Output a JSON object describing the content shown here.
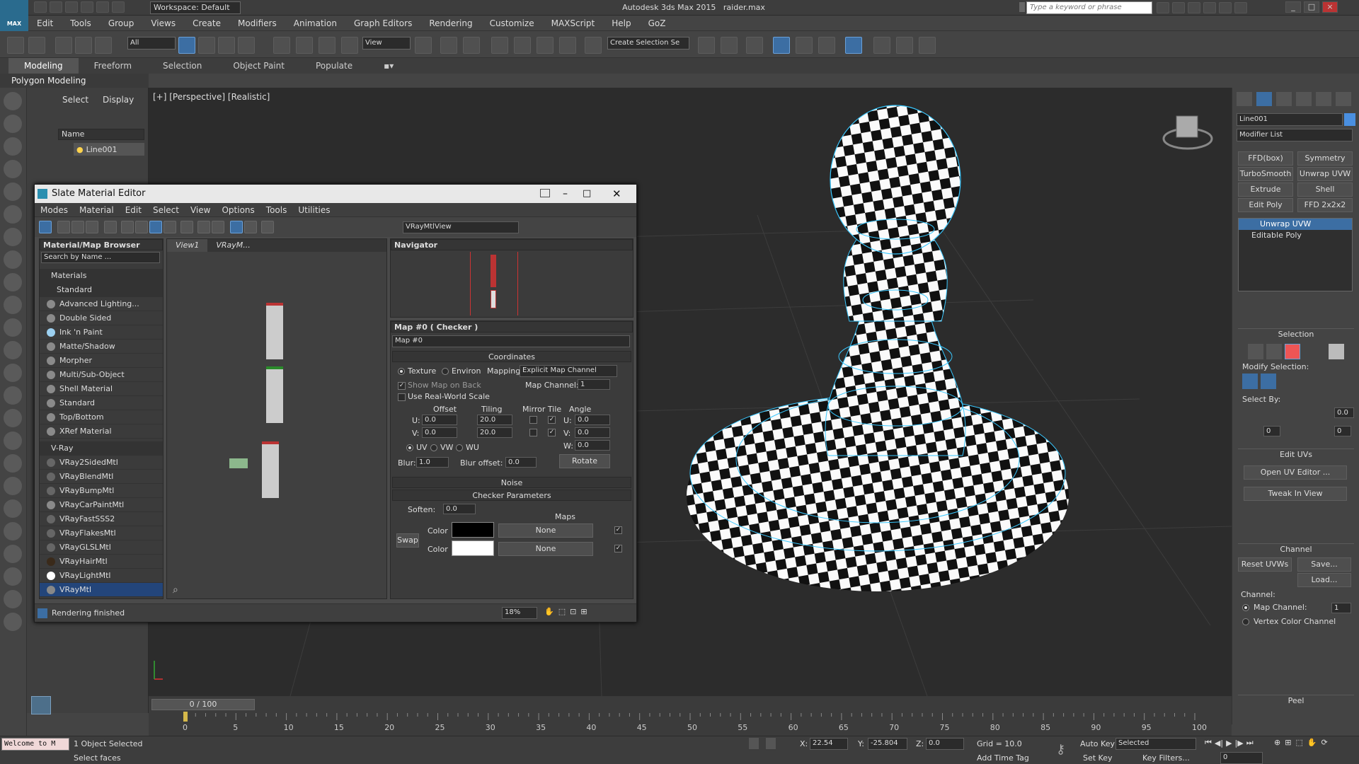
{
  "app": {
    "title": "Autodesk 3ds Max 2015",
    "file": "raider.max",
    "workspace": "Workspace: Default",
    "search_placeholder": "Type a keyword or phrase",
    "logo": "MAX"
  },
  "menu": [
    "Edit",
    "Tools",
    "Group",
    "Views",
    "Create",
    "Modifiers",
    "Animation",
    "Graph Editors",
    "Rendering",
    "Customize",
    "MAXScript",
    "Help",
    "GoZ"
  ],
  "toolbar": {
    "selection_filter": "All",
    "ref_coord": "View",
    "named_selection": "Create Selection Se"
  },
  "ribbon": {
    "tabs": [
      "Modeling",
      "Freeform",
      "Selection",
      "Object Paint",
      "Populate"
    ],
    "active": "Modeling",
    "sub": "Polygon Modeling"
  },
  "scene_explorer": {
    "tabs": [
      "Select",
      "Display"
    ],
    "column": "Name",
    "items": [
      "Line001"
    ]
  },
  "viewport": {
    "label": "[+] [Perspective] [Realistic]"
  },
  "command_panel": {
    "object_name": "Line001",
    "modifier_list": "Modifier List",
    "modifier_buttons": [
      "FFD(box)",
      "Symmetry",
      "TurboSmooth",
      "Unwrap UVW",
      "Extrude",
      "Shell",
      "Edit Poly",
      "FFD 2x2x2"
    ],
    "stack": [
      "Unwrap UVW",
      "Editable Poly"
    ],
    "selection": {
      "title": "Selection",
      "modify_selection": "Modify Selection:",
      "select_by": "Select By:",
      "val1": "0.0",
      "val2": "0",
      "val3": "0"
    },
    "edit_uvs": {
      "title": "Edit UVs",
      "open": "Open UV Editor ...",
      "tweak": "Tweak In View"
    },
    "channel": {
      "title": "Channel",
      "reset": "Reset UVWs",
      "save": "Save...",
      "load": "Load...",
      "label": "Channel:",
      "map_channel": "Map Channel:",
      "map_channel_value": "1",
      "vertex_color": "Vertex Color Channel"
    },
    "peel": {
      "title": "Peel"
    }
  },
  "timeline": {
    "counter": "0 / 100",
    "ticks": [
      "0",
      "5",
      "10",
      "15",
      "20",
      "25",
      "30",
      "35",
      "40",
      "45",
      "50",
      "55",
      "60",
      "65",
      "70",
      "75",
      "80",
      "85",
      "90",
      "95",
      "100"
    ]
  },
  "status": {
    "maxscript": "Welcome to M",
    "objects": "1 Object Selected",
    "prompt": "Select faces",
    "x_label": "X:",
    "x": "22.54",
    "y_label": "Y:",
    "y": "-25.804",
    "z_label": "Z:",
    "z": "0.0",
    "grid": "Grid = 10.0",
    "add_time_tag": "Add Time Tag",
    "auto_key": "Auto Key",
    "set_key": "Set Key",
    "key_mode": "Selected",
    "key_filters": "Key Filters...",
    "frame": "0"
  },
  "slate": {
    "title": "Slate Material Editor",
    "menu": [
      "Modes",
      "Material",
      "Edit",
      "Select",
      "View",
      "Options",
      "Tools",
      "Utilities"
    ],
    "view_dropdown": "VRayMtlView",
    "browser": {
      "title": "Material/Map Browser",
      "search": "Search by Name ...",
      "materials": "Materials",
      "standard": "Standard",
      "standard_items": [
        "Advanced Lighting...",
        "Double Sided",
        "Ink 'n Paint",
        "Matte/Shadow",
        "Morpher",
        "Multi/Sub-Object",
        "Shell Material",
        "Standard",
        "Top/Bottom",
        "XRef Material"
      ],
      "vray": "V-Ray",
      "vray_items": [
        "VRay2SidedMtl",
        "VRayBlendMtl",
        "VRayBumpMtl",
        "VRayCarPaintMtl",
        "VRayFastSSS2",
        "VRayFlakesMtl",
        "VRayGLSLMtl",
        "VRayHairMtl",
        "VRayLightMtl",
        "VRayMtl"
      ]
    },
    "view_tabs": [
      "View1",
      "VRayM..."
    ],
    "navigator": "Navigator",
    "map": {
      "header": "Map #0  ( Checker )",
      "name": "Map #0",
      "coordinates": "Coordinates",
      "texture": "Texture",
      "environ": "Environ",
      "mapping_label": "Mapping:",
      "mapping": "Explicit Map Channel",
      "show_map": "Show Map on Back",
      "map_channel_label": "Map Channel:",
      "map_channel": "1",
      "real_world": "Use Real-World Scale",
      "offset": "Offset",
      "tiling": "Tiling",
      "mirror_tile": "Mirror Tile",
      "angle": "Angle",
      "u_label": "U:",
      "v_label": "V:",
      "w_label": "W:",
      "u_offset": "0.0",
      "v_offset": "0.0",
      "u_tiling": "20.0",
      "v_tiling": "20.0",
      "u_angle": "0.0",
      "v_angle": "0.0",
      "w_angle": "0.0",
      "uv": "UV",
      "vw": "VW",
      "wu": "WU",
      "blur_label": "Blur:",
      "blur": "1.0",
      "blur_offset_label": "Blur offset:",
      "blur_offset": "0.0",
      "rotate": "Rotate",
      "noise": "Noise",
      "checker_params": "Checker Parameters",
      "soften_label": "Soften:",
      "soften": "0.0",
      "maps": "Maps",
      "swap": "Swap",
      "color1_label": "Color",
      "color2_label": "Color",
      "color1": "#000000",
      "color2": "#ffffff",
      "none1": "None",
      "none2": "None"
    },
    "status": "Rendering finished",
    "zoom": "18%"
  },
  "colors": {
    "accent": "#3c6ea3",
    "select": "#23457a",
    "viewport": "#2c2c2c"
  }
}
